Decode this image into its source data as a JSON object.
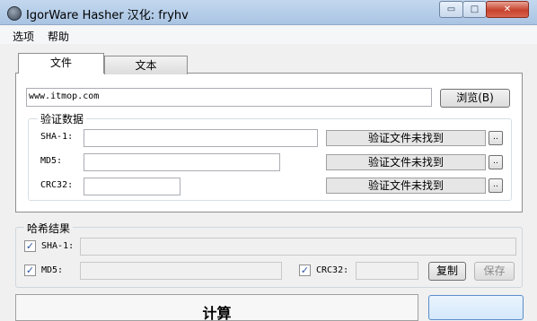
{
  "window": {
    "title": "IgorWare Hasher 汉化: fryhv",
    "minimize": "▭",
    "maximize": "□",
    "close": "✕"
  },
  "menu": {
    "items": [
      "选项",
      "帮助"
    ]
  },
  "tabs": [
    "文件",
    "文本"
  ],
  "file": {
    "path_value": "www.itmop.com",
    "browse_label": "浏览(B)"
  },
  "verify": {
    "title": "验证数据",
    "rows": [
      {
        "label": "SHA-1:",
        "status": "验证文件未找到",
        "more": ".."
      },
      {
        "label": "MD5:",
        "status": "验证文件未找到",
        "more": ".."
      },
      {
        "label": "CRC32:",
        "status": "验证文件未找到",
        "more": ".."
      }
    ]
  },
  "results": {
    "title": "哈希结果",
    "sha1_label": "SHA-1:",
    "md5_label": "MD5:",
    "crc32_label": "CRC32:",
    "copy_label": "复制",
    "save_label": "保存",
    "check_mark": "✓"
  },
  "bottom": {
    "action_label": "计算"
  }
}
